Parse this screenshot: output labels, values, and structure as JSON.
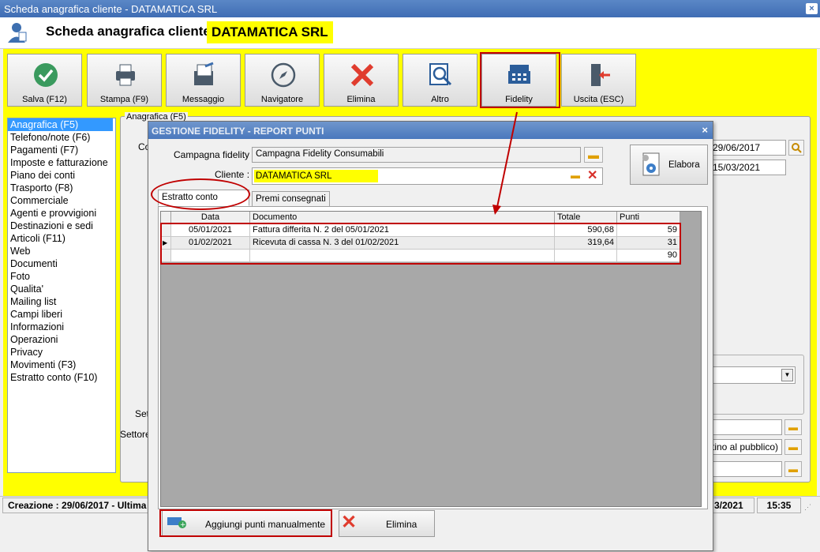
{
  "window": {
    "title": "Scheda anagrafica cliente - DATAMATICA SRL",
    "close": "×"
  },
  "header": {
    "title": "Scheda anagrafica cliente - ",
    "company": "DATAMATICA SRL"
  },
  "toolbar": [
    {
      "label": "Salva (F12)",
      "icon": "check-icon",
      "color": "#3a9a5e"
    },
    {
      "label": "Stampa (F9)",
      "icon": "printer-icon",
      "color": "#4a5a6a"
    },
    {
      "label": "Messaggio",
      "icon": "message-icon",
      "color": "#4a5a6a"
    },
    {
      "label": "Navigatore",
      "icon": "compass-icon",
      "color": "#4a5a6a"
    },
    {
      "label": "Elimina",
      "icon": "delete-icon",
      "color": "#e03c2e"
    },
    {
      "label": "Altro",
      "icon": "search-doc-icon",
      "color": "#2b5d9a"
    },
    {
      "label": "Fidelity",
      "icon": "cash-register-icon",
      "color": "#2b5d9a"
    },
    {
      "label": "Uscita (ESC)",
      "icon": "exit-icon",
      "color": "#4a5a6a"
    }
  ],
  "sidebar": [
    "Anagrafica (F5)",
    "Telefono/note (F6)",
    "Pagamenti (F7)",
    "Imposte e fatturazione",
    "Piano dei conti",
    "Trasporto (F8)",
    "Commerciale",
    "Agenti e provvigioni",
    "Destinazioni e sedi",
    "Articoli (F11)",
    "Web",
    "Documenti",
    "Foto",
    "Qualita'",
    "Mailing list",
    "Campi liberi",
    "Informazioni",
    "Operazioni",
    "Privacy",
    "Movimenti (F3)",
    "Estratto conto (F10)"
  ],
  "content": {
    "caption": "Anagrafica (F5)",
    "partial_label_1": "Co",
    "partial_label_2": "Set",
    "partial_label_3": "Settore",
    "date1": "29/06/2017",
    "date2": "15/03/2021",
    "partial_field": "tino al pubblico)"
  },
  "status": {
    "left": "Creazione : 29/06/2017 - Ultima",
    "mid": "3/2021",
    "time": "15:35"
  },
  "dialog": {
    "title": "GESTIONE FIDELITY - REPORT PUNTI",
    "close": "×",
    "campaign_label": "Campagna fidelity :",
    "campaign_value": "Campagna Fidelity Consumabili",
    "client_label": "Cliente :",
    "client_value": "DATAMATICA SRL",
    "elabora": "Elabora",
    "tabs": [
      "Estratto conto cliente",
      "Premi consegnati"
    ],
    "columns": [
      "Data",
      "Documento",
      "Totale",
      "Punti"
    ],
    "rows": [
      {
        "data": "05/01/2021",
        "documento": "Fattura differita N. 2 del 05/01/2021",
        "totale": "590,68",
        "punti": "59"
      },
      {
        "data": "01/02/2021",
        "documento": "Ricevuta di cassa N. 3 del 01/02/2021",
        "totale": "319,64",
        "punti": "31"
      },
      {
        "data": "",
        "documento": "",
        "totale": "",
        "punti": "90"
      }
    ],
    "add_button": "Aggiungi punti manualmente",
    "delete_button": "Elimina"
  },
  "colors": {
    "highlight": "#ffff00",
    "annotation": "#c00000",
    "selection": "#3399ff"
  }
}
